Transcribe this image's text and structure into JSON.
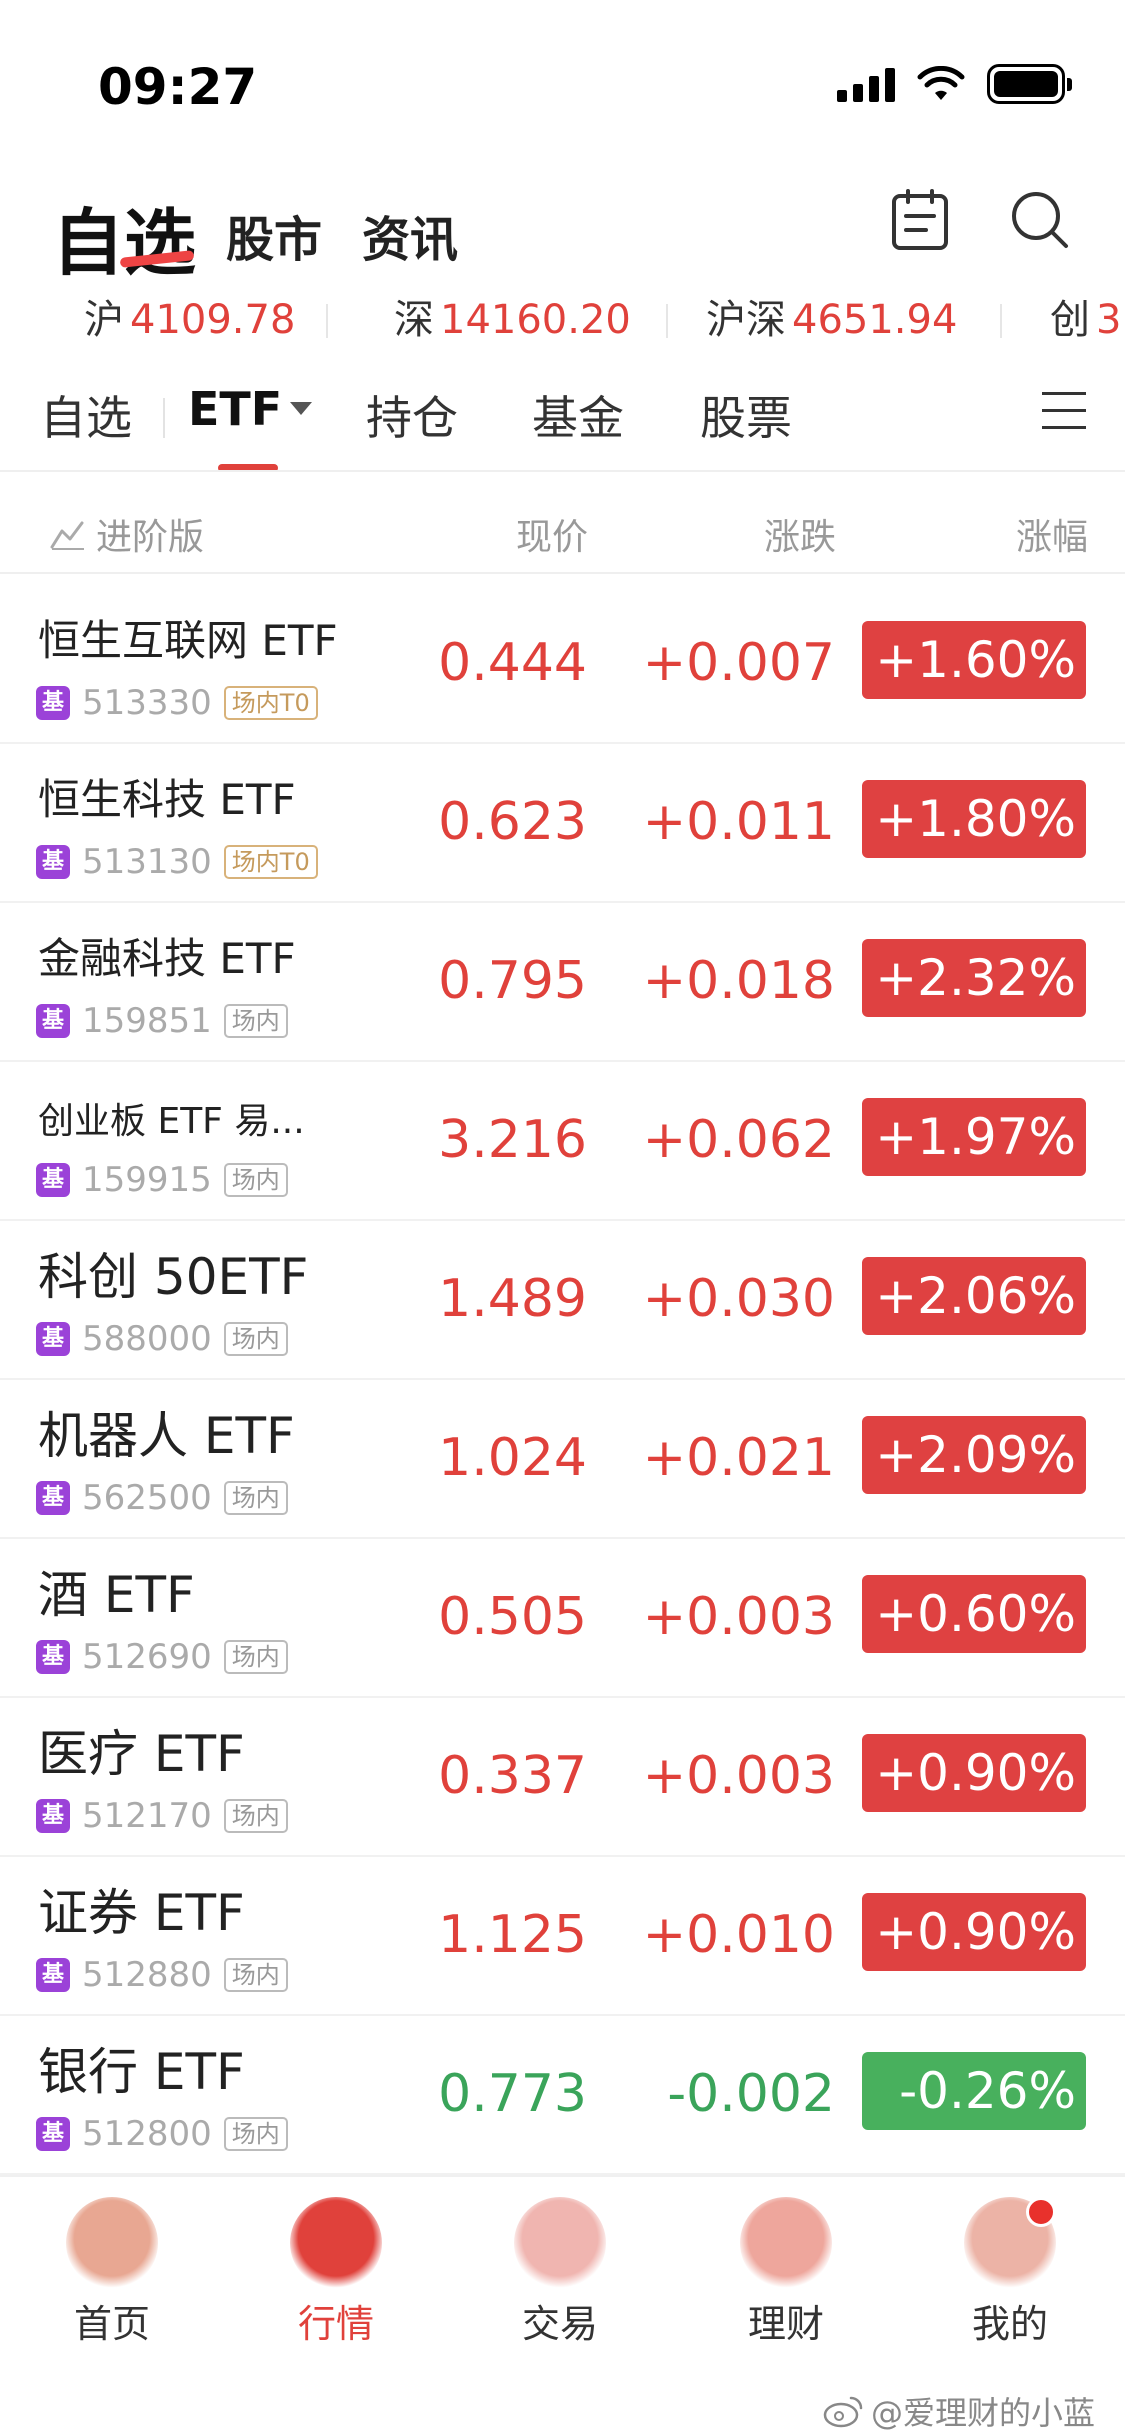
{
  "status_bar": {
    "time": "09:27"
  },
  "header": {
    "title": "自选",
    "tabs": [
      "股市",
      "资讯"
    ],
    "icons": [
      "notes-icon",
      "search-icon"
    ]
  },
  "index_strip": [
    {
      "name": "沪",
      "value": "4109.78"
    },
    {
      "name": "深",
      "value": "14160.20"
    },
    {
      "name": "沪深",
      "value": "4651.94"
    },
    {
      "name": "创",
      "value": "3"
    }
  ],
  "category_tabs": {
    "items": [
      "自选",
      "ETF",
      "持仓",
      "基金",
      "股票"
    ],
    "active": "ETF"
  },
  "columns": {
    "advanced": "进阶版",
    "price": "现价",
    "change": "涨跌",
    "percent": "涨幅"
  },
  "rows": [
    {
      "name": "恒生互联网 ETF",
      "code": "513330",
      "tag": "场内T0",
      "price": "0.444",
      "change": "+0.007",
      "percent": "+1.60%",
      "direction": "up"
    },
    {
      "name": "恒生科技 ETF",
      "code": "513130",
      "tag": "场内T0",
      "price": "0.623",
      "change": "+0.011",
      "percent": "+1.80%",
      "direction": "up"
    },
    {
      "name": "金融科技 ETF",
      "code": "159851",
      "tag": "场内",
      "price": "0.795",
      "change": "+0.018",
      "percent": "+2.32%",
      "direction": "up"
    },
    {
      "name": "创业板 ETF 易...",
      "code": "159915",
      "tag": "场内",
      "price": "3.216",
      "change": "+0.062",
      "percent": "+1.97%",
      "direction": "up"
    },
    {
      "name": "科创 50ETF",
      "code": "588000",
      "tag": "场内",
      "price": "1.489",
      "change": "+0.030",
      "percent": "+2.06%",
      "direction": "up"
    },
    {
      "name": "机器人 ETF",
      "code": "562500",
      "tag": "场内",
      "price": "1.024",
      "change": "+0.021",
      "percent": "+2.09%",
      "direction": "up"
    },
    {
      "name": "酒 ETF",
      "code": "512690",
      "tag": "场内",
      "price": "0.505",
      "change": "+0.003",
      "percent": "+0.60%",
      "direction": "up"
    },
    {
      "name": "医疗 ETF",
      "code": "512170",
      "tag": "场内",
      "price": "0.337",
      "change": "+0.003",
      "percent": "+0.90%",
      "direction": "up"
    },
    {
      "name": "证券 ETF",
      "code": "512880",
      "tag": "场内",
      "price": "1.125",
      "change": "+0.010",
      "percent": "+0.90%",
      "direction": "up"
    },
    {
      "name": "银行 ETF",
      "code": "512800",
      "tag": "场内",
      "price": "0.773",
      "change": "-0.002",
      "percent": "-0.26%",
      "direction": "down"
    }
  ],
  "fund_badge": "基",
  "bottom_nav": [
    {
      "label": "首页",
      "icon": "home-mascot-icon",
      "color": "#e8a792"
    },
    {
      "label": "行情",
      "icon": "market-gift-icon",
      "color": "#e0413b",
      "active": true
    },
    {
      "label": "交易",
      "icon": "lantern-icon",
      "color": "#f0b5b0"
    },
    {
      "label": "理财",
      "icon": "money-bag-icon",
      "color": "#eea69c"
    },
    {
      "label": "我的",
      "icon": "profile-mascot-icon",
      "color": "#ecb3a6",
      "badge": true
    }
  ],
  "watermark": "@爱理财的小蓝",
  "colors": {
    "up": "#df4141",
    "down": "#48b05d",
    "accent": "#e0413b",
    "fund_badge": "#9b42d8"
  }
}
